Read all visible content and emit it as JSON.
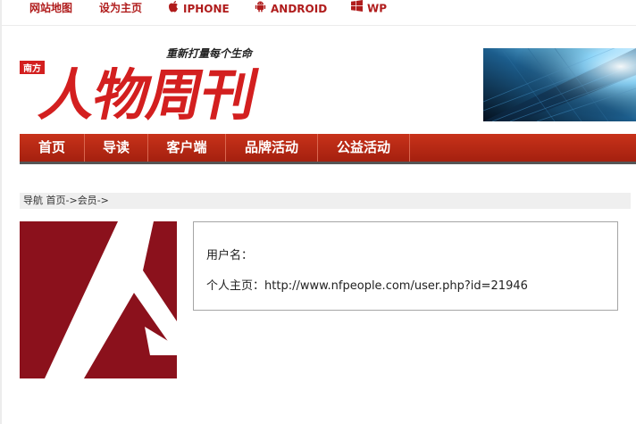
{
  "topbar": {
    "sitemap": "网站地图",
    "sethome": "设为主页",
    "iphone": "IPHONE",
    "android": "ANDROID",
    "wp": "WP"
  },
  "logo": {
    "badge": "南方",
    "slogan": "重新打量每个生命",
    "title": "人物周刊",
    "icon": "magazine-logo"
  },
  "colors": {
    "brand_red": "#c8321a",
    "link_red": "#b01c1c",
    "avatar_red": "#8b111c"
  },
  "nav": {
    "items": [
      {
        "label": "首页"
      },
      {
        "label": "导读"
      },
      {
        "label": "客户端"
      },
      {
        "label": "品牌活动"
      },
      {
        "label": "公益活动"
      }
    ]
  },
  "breadcrumb": {
    "prefix": "导航",
    "home": "首页",
    "sep1": "->",
    "member": "会员",
    "sep2": "->"
  },
  "profile": {
    "username_label": "用户名：",
    "homepage_label": "个人主页：",
    "homepage_url": "http://www.nfpeople.com/user.php?id=21946"
  }
}
